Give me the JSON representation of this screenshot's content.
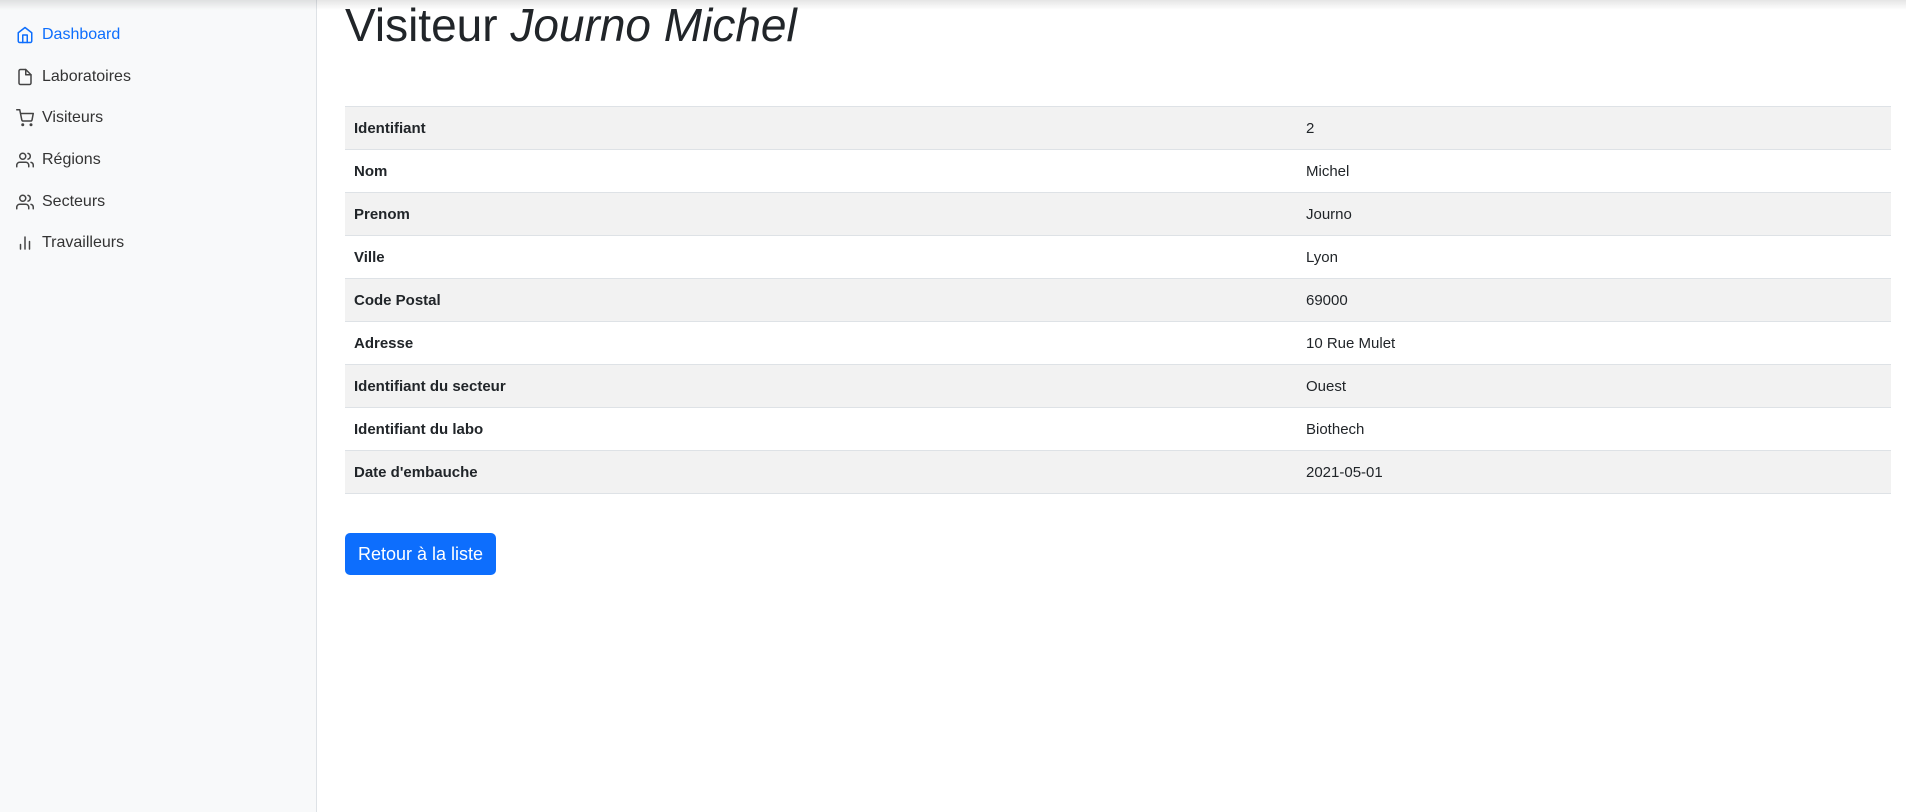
{
  "sidebar": {
    "items": [
      {
        "label": "Dashboard",
        "icon": "home-icon",
        "active": true
      },
      {
        "label": "Laboratoires",
        "icon": "file-icon",
        "active": false
      },
      {
        "label": "Visiteurs",
        "icon": "shopping-cart-icon",
        "active": false
      },
      {
        "label": "Régions",
        "icon": "users-icon",
        "active": false
      },
      {
        "label": "Secteurs",
        "icon": "users-icon",
        "active": false
      },
      {
        "label": "Travailleurs",
        "icon": "bar-chart-icon",
        "active": false
      }
    ]
  },
  "page": {
    "title_prefix": "Visiteur",
    "title_name": "Journo Michel"
  },
  "details": {
    "rows": [
      {
        "label": "Identifiant",
        "value": "2"
      },
      {
        "label": "Nom",
        "value": "Michel"
      },
      {
        "label": "Prenom",
        "value": "Journo"
      },
      {
        "label": "Ville",
        "value": "Lyon"
      },
      {
        "label": "Code Postal",
        "value": "69000"
      },
      {
        "label": "Adresse",
        "value": "10 Rue Mulet"
      },
      {
        "label": "Identifiant du secteur",
        "value": "Ouest"
      },
      {
        "label": "Identifiant du labo",
        "value": "Biothech"
      },
      {
        "label": "Date d'embauche",
        "value": "2021-05-01"
      }
    ]
  },
  "actions": {
    "back_label": "Retour à la liste"
  },
  "colors": {
    "accent": "#0d6efd",
    "sidebar_bg": "#f8f9fa",
    "stripe": "#f2f2f2"
  }
}
